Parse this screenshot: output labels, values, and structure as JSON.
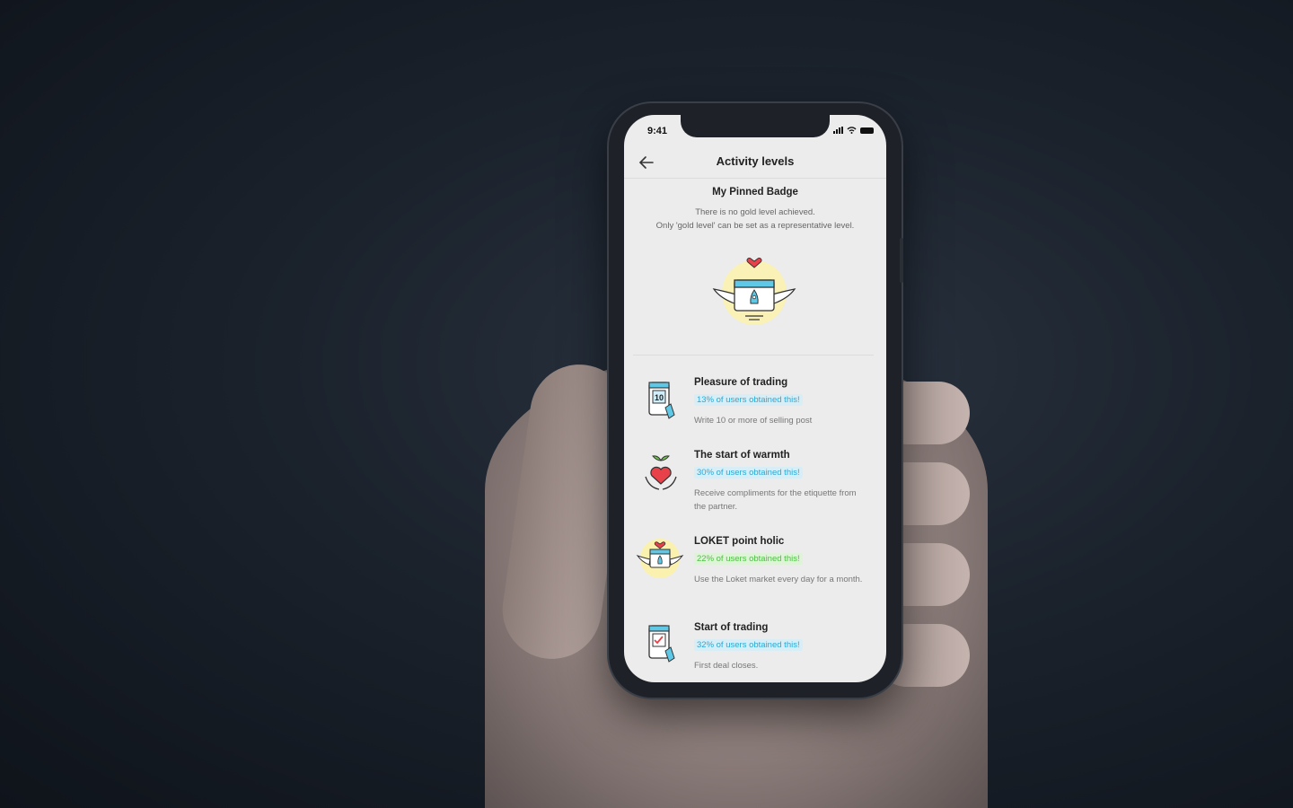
{
  "status_bar": {
    "time": "9:41"
  },
  "header": {
    "title": "Activity levels"
  },
  "pinned": {
    "title": "My Pinned Badge",
    "desc_line1": "There is no gold level achieved.",
    "desc_line2": "Only 'gold level' can be set as a representative level."
  },
  "badges": [
    {
      "name": "Pleasure of trading",
      "stat": "13% of users obtained this!",
      "desc": "Write 10 or more of selling post",
      "icon": "phone-10-icon",
      "stat_color": "blue",
      "calendar_number": "10"
    },
    {
      "name": "The start of warmth",
      "stat": "30% of users obtained this!",
      "desc": "Receive compliments for the etiquette from the partner.",
      "icon": "heart-sprout-hands-icon",
      "stat_color": "blue"
    },
    {
      "name": "LOKET point holic",
      "stat": "22% of users obtained this!",
      "desc": "Use the Loket market every day for a month.",
      "icon": "winged-calendar-icon",
      "stat_color": "green"
    },
    {
      "name": "Start of trading",
      "stat": "32% of users obtained this!",
      "desc": "First deal closes.",
      "icon": "phone-check-icon",
      "stat_color": "blue"
    }
  ],
  "colors": {
    "accent_blue": "#2aa8d4",
    "accent_green": "#4fbf45",
    "badge_glow": "#fff3a0",
    "heart": "#e8414a"
  }
}
